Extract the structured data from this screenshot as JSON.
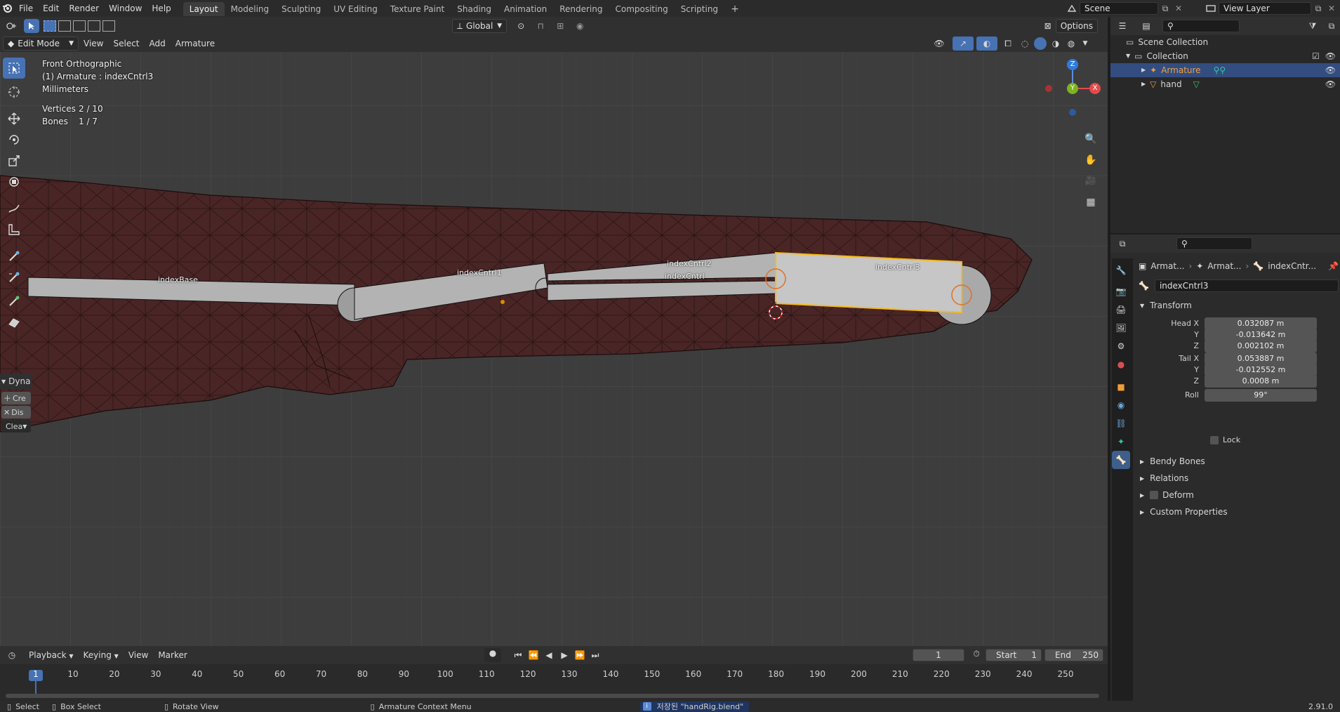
{
  "topbar": {
    "menus": [
      "File",
      "Edit",
      "Render",
      "Window",
      "Help"
    ],
    "workspaces": [
      "Layout",
      "Modeling",
      "Sculpting",
      "UV Editing",
      "Texture Paint",
      "Shading",
      "Animation",
      "Rendering",
      "Compositing",
      "Scripting"
    ],
    "active_workspace": "Layout",
    "add_tab": "+",
    "scene": "Scene",
    "view_layer": "View Layer"
  },
  "viewport": {
    "mode": "Edit Mode",
    "menus": [
      "View",
      "Select",
      "Add",
      "Armature"
    ],
    "orientation": "Global",
    "options": "Options",
    "view_name": "Front Orthographic",
    "active_object": "(1) Armature : indexCntrl3",
    "units": "Millimeters",
    "stats": [
      {
        "label": "Vertices",
        "value": "2 / 10"
      },
      {
        "label": "Bones",
        "value": "1 / 7"
      }
    ],
    "bones": [
      "indexBase",
      "indexCntrl1",
      "indexCntrl2",
      "indexCntrl",
      "indexCntrl3"
    ],
    "gizmo_axes": {
      "z": "Z",
      "y": "Y",
      "x": "X"
    },
    "last_op_panel": {
      "title": "Dyna",
      "buttons": [
        "Cre",
        "Dis",
        "Clea"
      ]
    },
    "mesh_color": "#4a2525",
    "select_color": "#f5b91d"
  },
  "timeline": {
    "menus": [
      "Playback",
      "Keying",
      "View",
      "Marker"
    ],
    "current_frame": "1",
    "start_label": "Start",
    "start": "1",
    "end_label": "End",
    "end": "250",
    "ticks": [
      "1",
      "10",
      "20",
      "30",
      "40",
      "50",
      "60",
      "70",
      "80",
      "90",
      "100",
      "110",
      "120",
      "130",
      "140",
      "150",
      "160",
      "170",
      "180",
      "190",
      "200",
      "210",
      "220",
      "230",
      "240",
      "250"
    ]
  },
  "statusbar": {
    "select": "Select",
    "box_select": "Box Select",
    "rotate_view": "Rotate View",
    "context_menu": "Armature Context Menu",
    "message": "저장된 \"handRig.blend\"",
    "version": "2.91.0"
  },
  "outliner": {
    "root": "Scene Collection",
    "collection": "Collection",
    "items": [
      "Armature",
      "hand"
    ]
  },
  "properties": {
    "breadcrumb": [
      "Armat...",
      "Armat...",
      "indexCntr..."
    ],
    "bone_name": "indexCntrl3",
    "transform_header": "Transform",
    "fields": [
      {
        "label": "Head X",
        "value": "0.032087 m"
      },
      {
        "label": "Y",
        "value": "-0.013642 m"
      },
      {
        "label": "Z",
        "value": "0.002102 m"
      },
      {
        "label": "Tail X",
        "value": "0.053887 m"
      },
      {
        "label": "Y",
        "value": "-0.012552 m"
      },
      {
        "label": "Z",
        "value": "0.0008 m"
      },
      {
        "label": "Roll",
        "value": "99°"
      }
    ],
    "lock_label": "Lock",
    "panels": [
      "Bendy Bones",
      "Relations",
      "Deform",
      "Custom Properties"
    ]
  }
}
